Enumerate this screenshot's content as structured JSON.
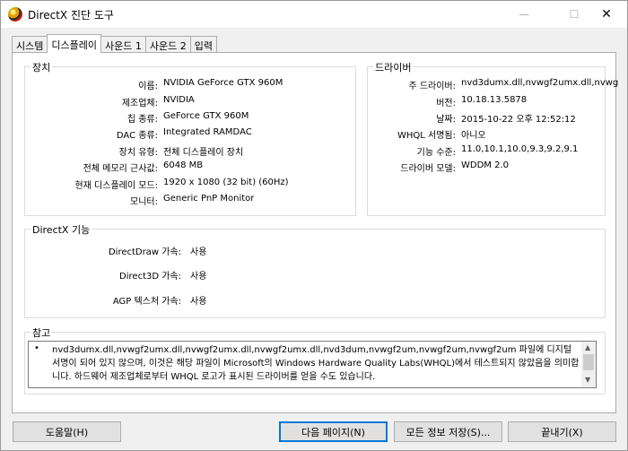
{
  "window": {
    "title": "DirectX 진단 도구",
    "minimize": "—",
    "maximize": "☐",
    "close": "✕"
  },
  "tabs": [
    {
      "label": "시스템"
    },
    {
      "label": "디스플레이"
    },
    {
      "label": "사운드 1"
    },
    {
      "label": "사운드 2"
    },
    {
      "label": "입력"
    }
  ],
  "device": {
    "title": "장치",
    "rows": [
      {
        "label": "이름:",
        "value": "NVIDIA GeForce GTX 960M"
      },
      {
        "label": "제조업체:",
        "value": "NVIDIA"
      },
      {
        "label": "칩 종류:",
        "value": "GeForce GTX 960M"
      },
      {
        "label": "DAC 종류:",
        "value": "Integrated RAMDAC"
      },
      {
        "label": "장치 유형:",
        "value": "전체 디스플레이 장치"
      },
      {
        "label": "전체 메모리 근사값:",
        "value": "6048 MB"
      },
      {
        "label": "현재 디스플레이 모드:",
        "value": "1920 x 1080 (32 bit) (60Hz)"
      },
      {
        "label": "모니터:",
        "value": "Generic PnP Monitor"
      }
    ]
  },
  "driver": {
    "title": "드라이버",
    "rows": [
      {
        "label": "주 드라이버:",
        "value": "nvd3dumx.dll,nvwgf2umx.dll,nvwg"
      },
      {
        "label": "버전:",
        "value": "10.18.13.5878"
      },
      {
        "label": "날짜:",
        "value": "2015-10-22 오후 12:52:12"
      },
      {
        "label": "WHQL 서명됨:",
        "value": "아니오"
      },
      {
        "label": "기능 수준:",
        "value": "11.0,10.1,10.0,9.3,9.2,9.1"
      },
      {
        "label": "드라이버 모델:",
        "value": "WDDM 2.0"
      }
    ]
  },
  "directx": {
    "title": "DirectX 기능",
    "rows": [
      {
        "label": "DirectDraw 가속:",
        "value": "사용"
      },
      {
        "label": "Direct3D 가속:",
        "value": "사용"
      },
      {
        "label": "AGP 텍스처 가속:",
        "value": "사용"
      }
    ]
  },
  "notes": {
    "title": "참고",
    "bullet": "•",
    "text": "nvd3dumx.dll,nvwgf2umx.dll,nvwgf2umx.dll,nvwgf2umx.dll,nvd3dum,nvwgf2um,nvwgf2um,nvwgf2um 파일에 디지털 서명이 되어 있지 않으며, 이것은 해당 파일이 Microsoft의 Windows Hardware Quality Labs(WHQL)에서 테스트되지 않았음을 의미합니다. 하드웨어 제조업체로부터 WHQL 로고가 표시된 드라이버를 얻을 수도 있습니다.",
    "scroll_up": "▲",
    "scroll_down": "▼"
  },
  "buttons": {
    "help": "도움말(H)",
    "next": "다음 페이지(N)",
    "save": "모든 정보 저장(S)...",
    "exit": "끝내기(X)"
  }
}
